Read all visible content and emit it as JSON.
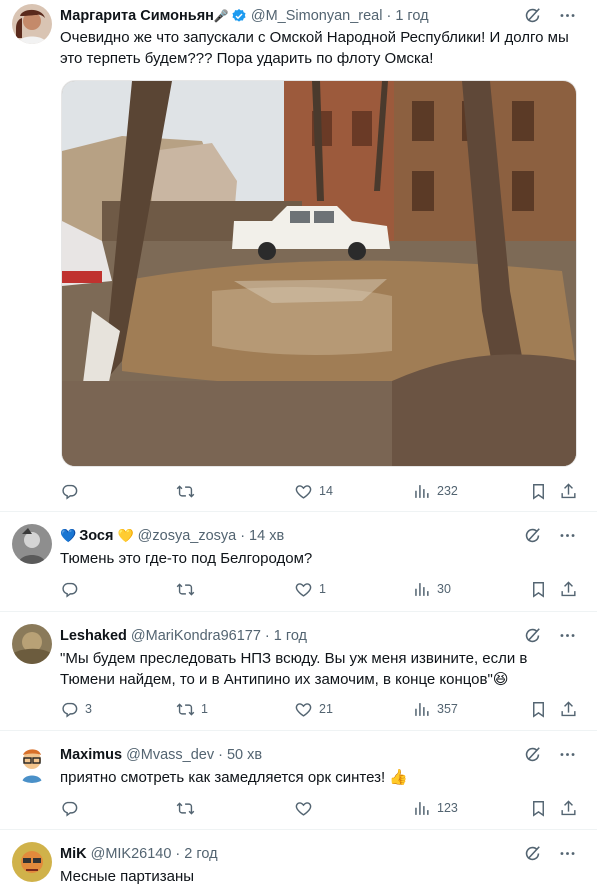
{
  "tweets": [
    {
      "name": "Маргарита Симоньян",
      "name_emoji": "🎤",
      "verified": true,
      "handle": "@M_Simonyan_real",
      "time": "1 год",
      "text": "Очевидно же что запускали с Омской Народной Республики! И долго мы это терпеть будем??? Пора ударить по флоту Омска!",
      "replies": "",
      "retweets": "",
      "likes": "14",
      "views": "232"
    },
    {
      "name_prefix_emoji": "💙",
      "name": "Зося",
      "name_emoji": "💛",
      "handle": "@zosya_zosya",
      "time": "14 хв",
      "text": "Тюмень это где-то под Белгородом?",
      "replies": "",
      "retweets": "",
      "likes": "1",
      "views": "30"
    },
    {
      "name": "Leshaked",
      "handle": "@MariKondra96177",
      "time": "1 год",
      "text": "\"Мы будем преследовать НПЗ всюду. Вы уж меня извините, если в Тюмени найдем, то и в Антипино их замочим, в конце концов\"😆",
      "replies": "3",
      "retweets": "1",
      "likes": "21",
      "views": "357"
    },
    {
      "name": "Maximus",
      "handle": "@Mvass_dev",
      "time": "50 хв",
      "text": "приятно смотреть как замедляется орк синтез! 👍",
      "replies": "",
      "retweets": "",
      "likes": "",
      "views": "123"
    },
    {
      "name": "MiK",
      "handle": "@MIK26140",
      "time": "2 год",
      "text": "Месные партизаны"
    }
  ],
  "icons": {
    "grok": "grok-icon",
    "more": "more-icon",
    "reply": "reply-icon",
    "retweet": "retweet-icon",
    "like": "like-icon",
    "views": "views-icon",
    "bookmark": "bookmark-icon",
    "share": "share-icon"
  },
  "colors": {
    "text": "#0f1419",
    "secondary": "#536471",
    "verified": "#1d9bf0",
    "divider": "#eff3f4"
  }
}
